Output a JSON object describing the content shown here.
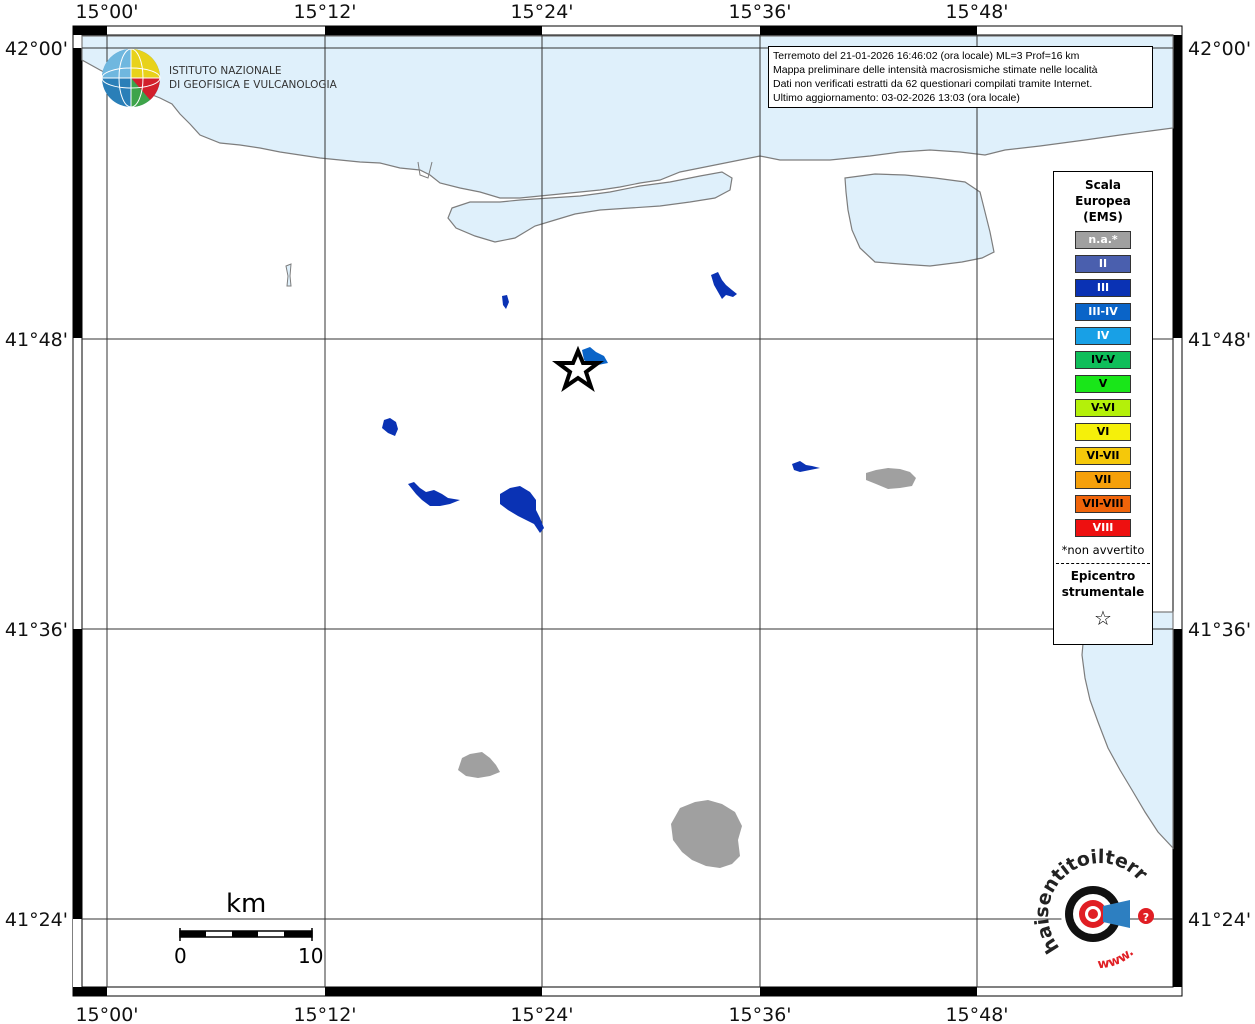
{
  "map": {
    "lon_ticks": [
      "15°00'",
      "15°12'",
      "15°24'",
      "15°36'",
      "15°48'"
    ],
    "lat_ticks": [
      "42°00'",
      "41°48'",
      "41°36'",
      "41°24'"
    ]
  },
  "info": {
    "line1": "Terremoto del 21-01-2026 16:46:02 (ora locale) ML=3 Prof=16 km",
    "line2": "Mappa preliminare delle intensità macrosismiche stimate nelle località",
    "line3": "Dati non verificati estratti da 62 questionari compilati tramite Internet.",
    "line4": "Ultimo aggiornamento: 03-02-2026 13:03 (ora locale)"
  },
  "logo": {
    "line1": "ISTITUTO NAZIONALE",
    "line2": "DI GEOFISICA E VULCANOLOGIA"
  },
  "legend": {
    "title1": "Scala",
    "title2": "Europea",
    "title3": "(EMS)",
    "items": [
      {
        "label": "n.a.*",
        "color": "#a0a0a0",
        "text_color": "#ffffff"
      },
      {
        "label": "II",
        "color": "#4a5fae",
        "text_color": "#ffffff"
      },
      {
        "label": "III",
        "color": "#0a32b4",
        "text_color": "#ffffff"
      },
      {
        "label": "III-IV",
        "color": "#0a64c8",
        "text_color": "#ffffff"
      },
      {
        "label": "IV",
        "color": "#18a0e6",
        "text_color": "#ffffff"
      },
      {
        "label": "IV-V",
        "color": "#0fbe5a",
        "text_color": "#000000"
      },
      {
        "label": "V",
        "color": "#19e619",
        "text_color": "#000000"
      },
      {
        "label": "V-VI",
        "color": "#b4f00a",
        "text_color": "#000000"
      },
      {
        "label": "VI",
        "color": "#f5f00a",
        "text_color": "#000000"
      },
      {
        "label": "VI-VII",
        "color": "#f5c80a",
        "text_color": "#000000"
      },
      {
        "label": "VII",
        "color": "#f5a00a",
        "text_color": "#000000"
      },
      {
        "label": "VII-VIII",
        "color": "#f0640a",
        "text_color": "#000000"
      },
      {
        "label": "VIII",
        "color": "#ee1010",
        "text_color": "#ffffff"
      }
    ],
    "note": "*non avvertito",
    "epicenter1": "Epicentro",
    "epicenter2": "strumentale"
  },
  "scale": {
    "title": "km",
    "min": "0",
    "max": "10"
  },
  "haisentito": {
    "text": "haisentitoilterremoto.it",
    "prefix": "www."
  },
  "colors": {
    "sea": "#dff0fb",
    "coast": "#7d7d7d",
    "intensity_III": "#0a32b4",
    "not_felt": "#a0a0a0",
    "brand_red": "#e01e24"
  }
}
